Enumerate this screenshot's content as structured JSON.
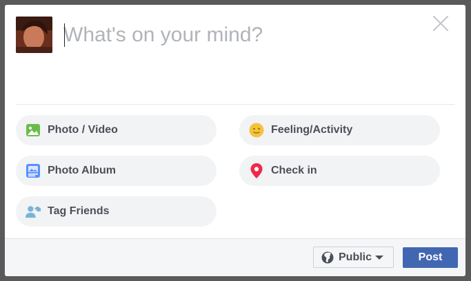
{
  "composer": {
    "placeholder": "What's on your mind?",
    "value": ""
  },
  "actions": [
    {
      "label": "Photo / Video",
      "icon": "photo-video-icon"
    },
    {
      "label": "Feeling/Activity",
      "icon": "feeling-smiley-icon"
    },
    {
      "label": "Photo Album",
      "icon": "photo-album-icon"
    },
    {
      "label": "Check in",
      "icon": "location-pin-icon"
    },
    {
      "label": "Tag Friends",
      "icon": "tag-friends-icon"
    }
  ],
  "footer": {
    "privacy_label": "Public",
    "post_label": "Post"
  },
  "colors": {
    "post_button": "#4267b2",
    "photo_icon": "#6bbd4b",
    "feeling_icon": "#f5c33b",
    "album_icon": "#5890ff",
    "checkin_icon": "#f02849",
    "tag_icon": "#7ab3d9"
  }
}
